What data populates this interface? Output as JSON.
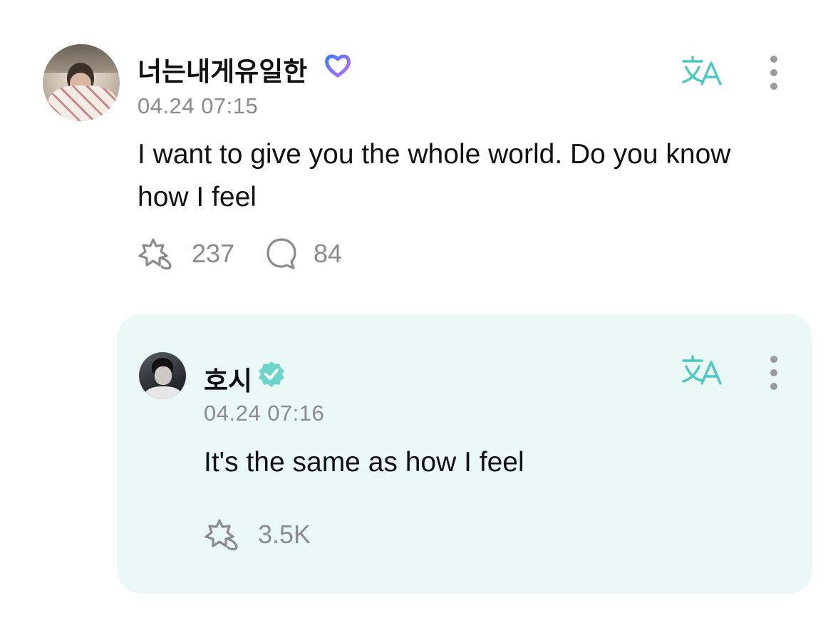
{
  "post": {
    "username": "너는내게유일한",
    "badge_icon": "heart-badge-icon",
    "timestamp": "04.24 07:15",
    "text": "I want to give you the whole world. Do you know how I feel",
    "like_count": "237",
    "comment_count": "84"
  },
  "reply": {
    "username": "호시",
    "badge_icon": "verified-badge-icon",
    "timestamp": "04.24 07:16",
    "text": "It's the same as how I feel",
    "like_count": "3.5K"
  },
  "icons": {
    "translate": "translate-icon",
    "more": "more-vertical-icon",
    "like": "like-icon",
    "comment": "comment-icon"
  },
  "colors": {
    "accent": "#4cc9c0",
    "reply_background": "#eaf9f6",
    "muted_text": "#8b8b8b",
    "heart_badge_start": "#3c7bff",
    "heart_badge_end": "#c06cf2"
  }
}
